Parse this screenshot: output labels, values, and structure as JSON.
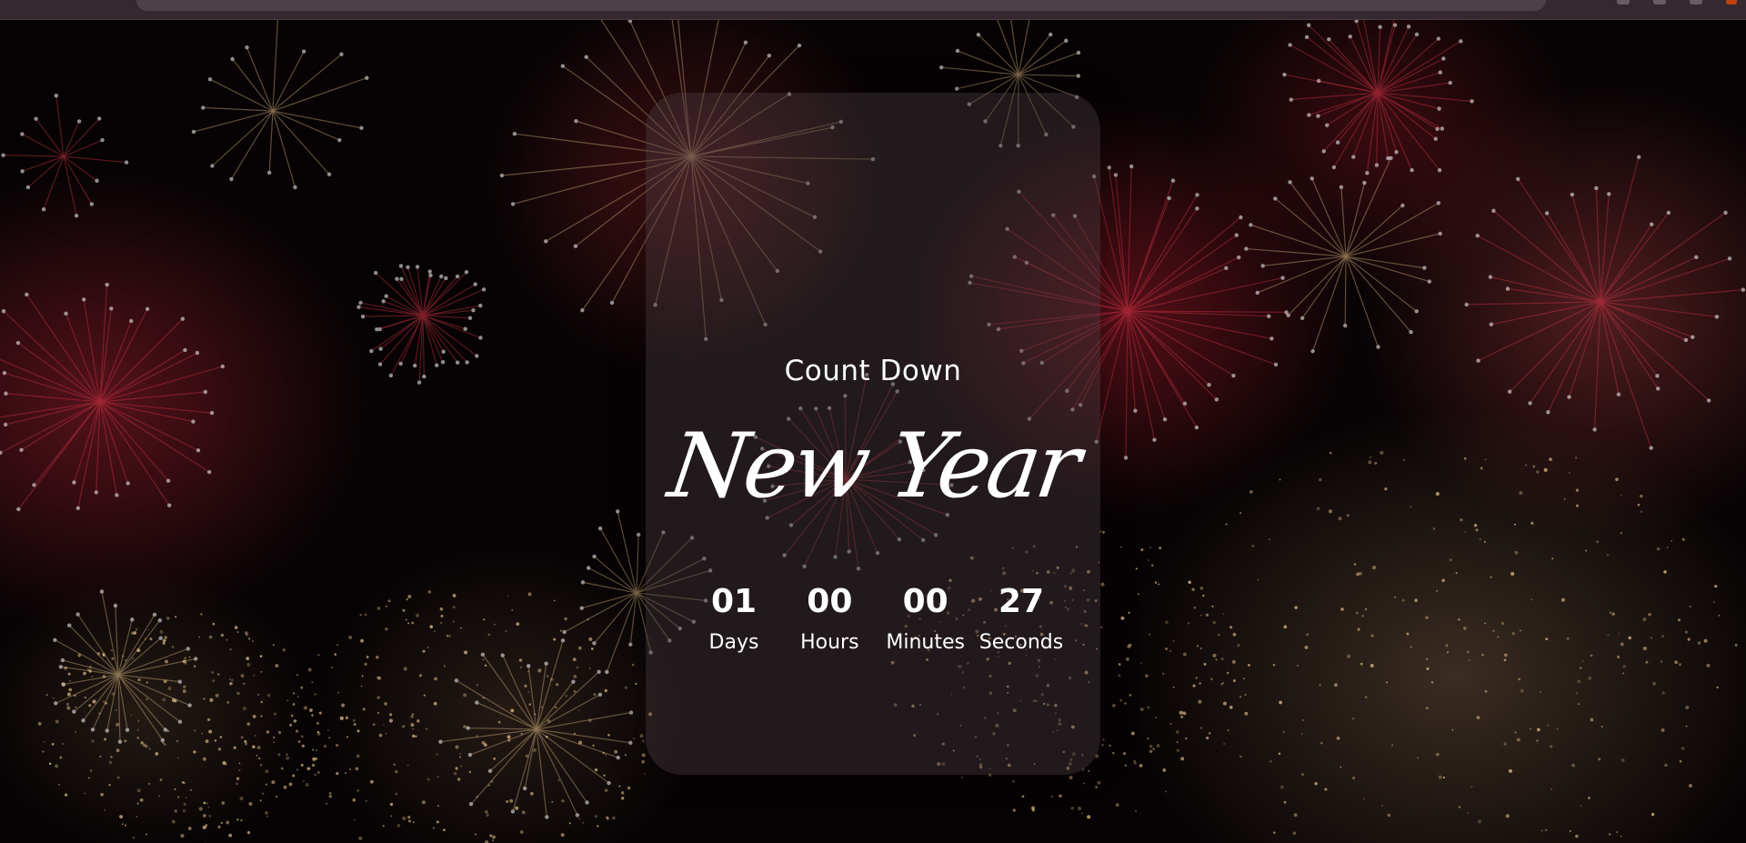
{
  "page": {
    "subtitle": "Count Down",
    "title": "New Year",
    "background": "fireworks-night-sky"
  },
  "countdown": [
    {
      "value": "01",
      "label": "Days"
    },
    {
      "value": "00",
      "label": "Hours"
    },
    {
      "value": "00",
      "label": "Minutes"
    },
    {
      "value": "27",
      "label": "Seconds"
    }
  ],
  "colors": {
    "text": "#ffffff",
    "card": "#463a3e",
    "sky": "#070304",
    "firework_red": "#e03848",
    "firework_gold": "#e8c48a"
  }
}
